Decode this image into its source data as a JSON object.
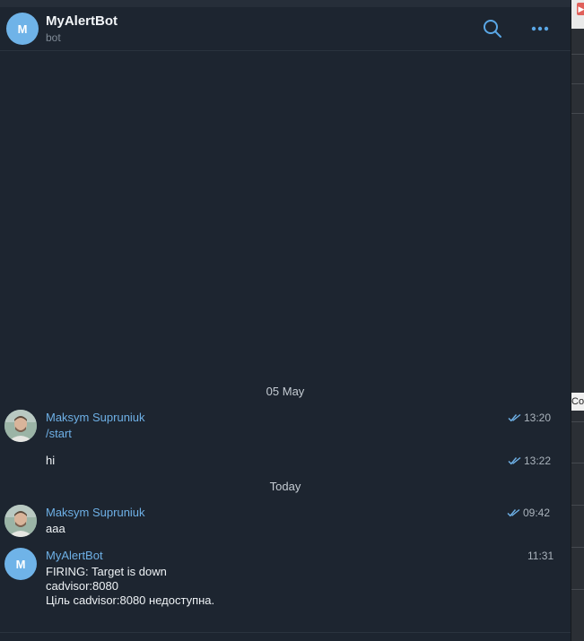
{
  "header": {
    "avatar_letter": "M",
    "title": "MyAlertBot",
    "subtitle": "bot",
    "search_icon": "search-icon",
    "more_icon": "more-horizontal-icon"
  },
  "messages": {
    "date1": "05 May",
    "m1": {
      "sender": "Maksym Supruniuk",
      "text": "/start",
      "time": "13:20",
      "status": "read"
    },
    "m2": {
      "text": "hi",
      "time": "13:22",
      "status": "read"
    },
    "date2": "Today",
    "m3": {
      "sender": "Maksym Supruniuk",
      "text": "aaa",
      "time": "09:42",
      "status": "read"
    },
    "m4": {
      "avatar_letter": "M",
      "sender": "MyAlertBot",
      "time": "11:31",
      "line1": "FIRING: Target is down",
      "line2": "cadvisor:8080",
      "line3": "Ціль cadvisor:8080 недоступна."
    }
  },
  "sidepanel": {
    "label": "Cop"
  },
  "colors": {
    "accent": "#6eb0e6",
    "avatar": "#6fb3e8",
    "background": "#1d2530"
  }
}
